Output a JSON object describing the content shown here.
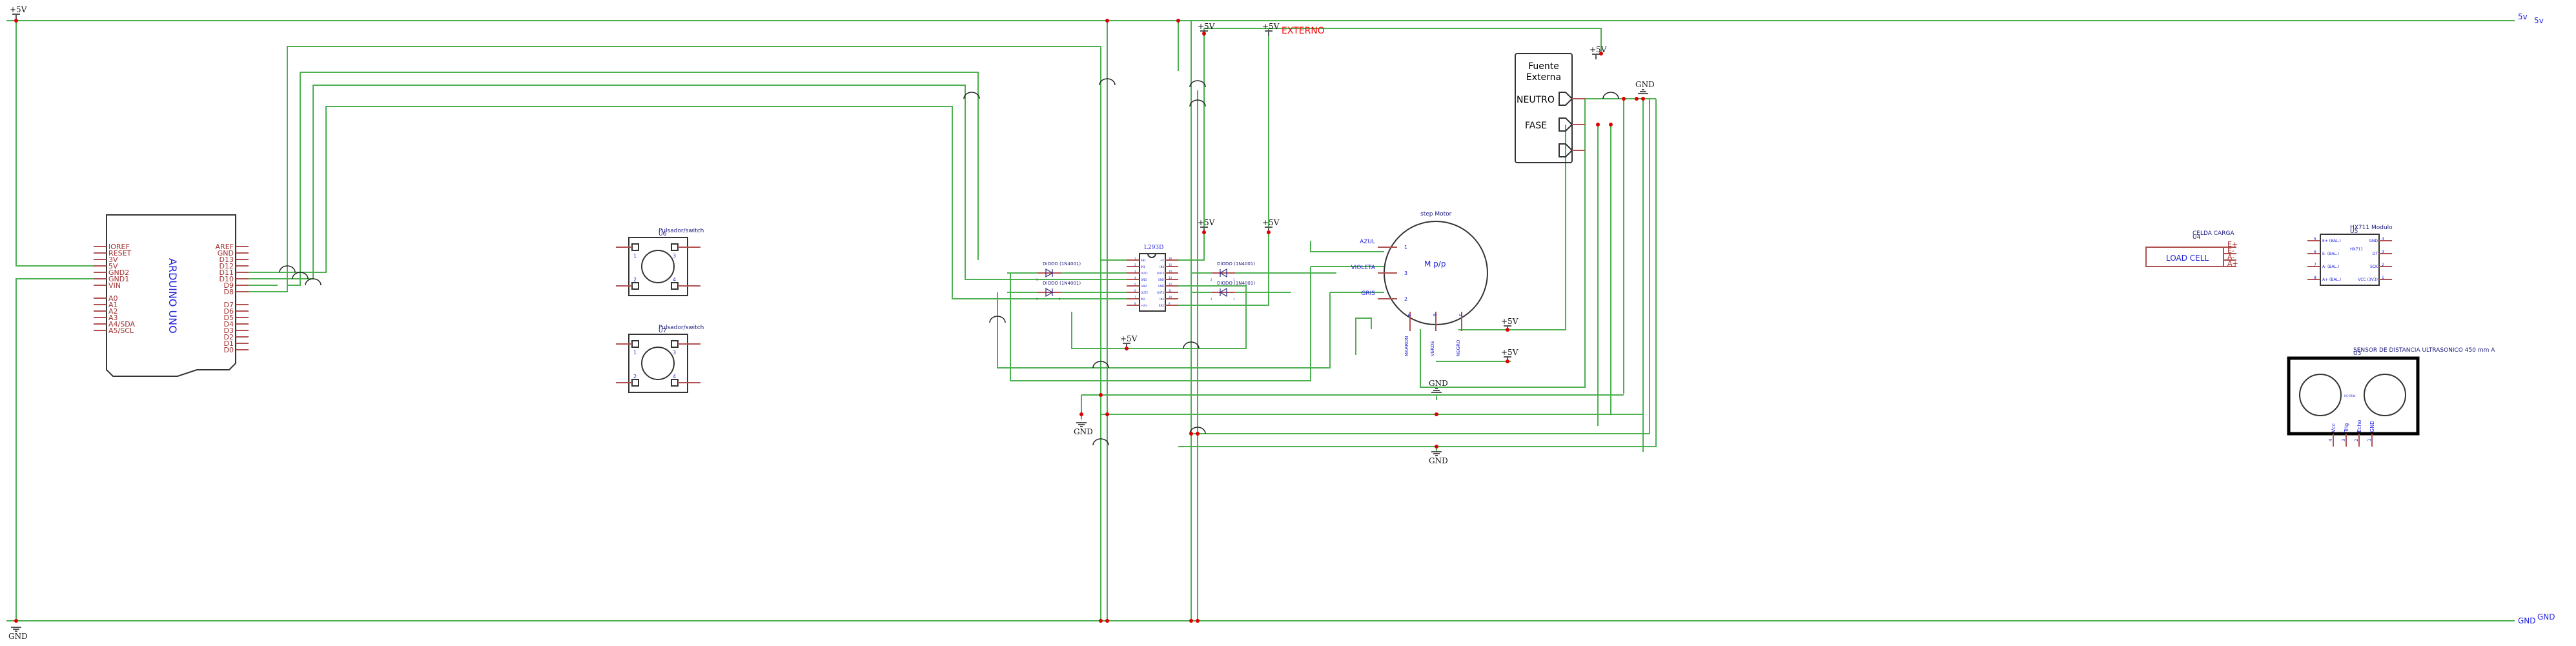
{
  "rails": {
    "top_label": "5v",
    "top_label_2": "5v",
    "bottom_label": "GND",
    "bottom_label_2": "GND"
  },
  "power": {
    "plus5v": "+5V",
    "gnd": "GND",
    "externo": "EXTERNO"
  },
  "arduino": {
    "title": "ARDUINO UNO",
    "left_pins": [
      "IOREF",
      "RESET",
      "3V",
      "5V",
      "GND2",
      "GND1",
      "VIN",
      "",
      "A0",
      "A1",
      "A2",
      "A3",
      "A4/SDA",
      "A5/SCL"
    ],
    "right_pins": [
      "AREF",
      "GND",
      "D13",
      "D12",
      "D11",
      "D10",
      "D9",
      "D8",
      "",
      "D7",
      "D6",
      "D5",
      "D4",
      "D3",
      "D2",
      "D1",
      "D0"
    ]
  },
  "switches": [
    {
      "name": "Pulsador/switch",
      "ref": "U6",
      "pins": [
        "1",
        "3",
        "2",
        "4"
      ]
    },
    {
      "name": "Pulsador/switch",
      "ref": "U7",
      "pins": [
        "1",
        "3",
        "2",
        "4"
      ]
    }
  ],
  "l293d": {
    "title": "L293D",
    "left_pins": [
      {
        "n": "1",
        "l": "EN1"
      },
      {
        "n": "2",
        "l": "IN1"
      },
      {
        "n": "3",
        "l": "OUT1"
      },
      {
        "n": "4",
        "l": "GND"
      },
      {
        "n": "5",
        "l": "GND"
      },
      {
        "n": "6",
        "l": "OUT2"
      },
      {
        "n": "7",
        "l": "IN2"
      },
      {
        "n": "8",
        "l": "+Vm"
      }
    ],
    "right_pins": [
      {
        "n": "16",
        "l": "+V"
      },
      {
        "n": "15",
        "l": "IN4"
      },
      {
        "n": "14",
        "l": "OUT4"
      },
      {
        "n": "13",
        "l": "GND"
      },
      {
        "n": "12",
        "l": "GND"
      },
      {
        "n": "11",
        "l": "OUT3"
      },
      {
        "n": "10",
        "l": "IN3"
      },
      {
        "n": "9",
        "l": "EN2"
      }
    ]
  },
  "diodes": [
    {
      "label": "DIODO (1N4001)",
      "p1": "1",
      "p2": ""
    },
    {
      "label": "DIODO (1N4001)",
      "p1": "1",
      "p2": "2"
    },
    {
      "label": "DIODO (1N4001)",
      "p1": "2",
      "p2": "1"
    },
    {
      "label": "DIODO (1N4001)",
      "p1": "2",
      "p2": "1"
    }
  ],
  "motor": {
    "name": "step Motor",
    "symbol": "M p/p",
    "wires": [
      {
        "color": "AZUL",
        "pin": "1"
      },
      {
        "color": "VIOLETA",
        "pin": "3"
      },
      {
        "color": "GRIS",
        "pin": "2"
      },
      {
        "color": "MARRON",
        "pin": "4"
      },
      {
        "color": "VERDE",
        "pin": "6"
      },
      {
        "color": "NEGRO",
        "pin": "5"
      }
    ]
  },
  "fuente": {
    "title1": "Fuente",
    "title2": "Externa",
    "neutro": "NEUTRO",
    "fase": "FASE"
  },
  "load_cell": {
    "name": "CELDA CARGA",
    "ref": "U4",
    "label": "LOAD CELL",
    "pins": [
      "E+",
      "E-",
      "A-",
      "A+"
    ]
  },
  "hx711": {
    "name": "HX711 Modulo",
    "ref": "U5",
    "chip": "HX711",
    "left_pins": [
      {
        "n": "5",
        "l": "E+ (BAL.)"
      },
      {
        "n": "6",
        "l": "E- (BAL.)"
      },
      {
        "n": "7",
        "l": "A- (BAL.)"
      },
      {
        "n": "8",
        "l": "A+ (BAL.)"
      }
    ],
    "right_pins": [
      {
        "n": "4",
        "l": "GND"
      },
      {
        "n": "3",
        "l": "DT"
      },
      {
        "n": "2",
        "l": "SCK"
      },
      {
        "n": "1",
        "l": "VCC (3V3)"
      }
    ]
  },
  "sensor": {
    "name": "SENSOR DE DISTANCIA ULTRASONICO 450 mm A",
    "ref": "U3",
    "chip": "HC-SR04",
    "pins": [
      {
        "n": "4",
        "l": "Vcc"
      },
      {
        "n": "3",
        "l": "Trig"
      },
      {
        "n": "2",
        "l": "Echo"
      },
      {
        "n": "1",
        "l": "GND"
      }
    ]
  },
  "colors": {
    "wire": "#4caf50",
    "pin": "#b05050",
    "junction": "#dd0000",
    "label_blue": "#2222dd",
    "pin_label": "#a03030",
    "externo": "#ff0000"
  }
}
